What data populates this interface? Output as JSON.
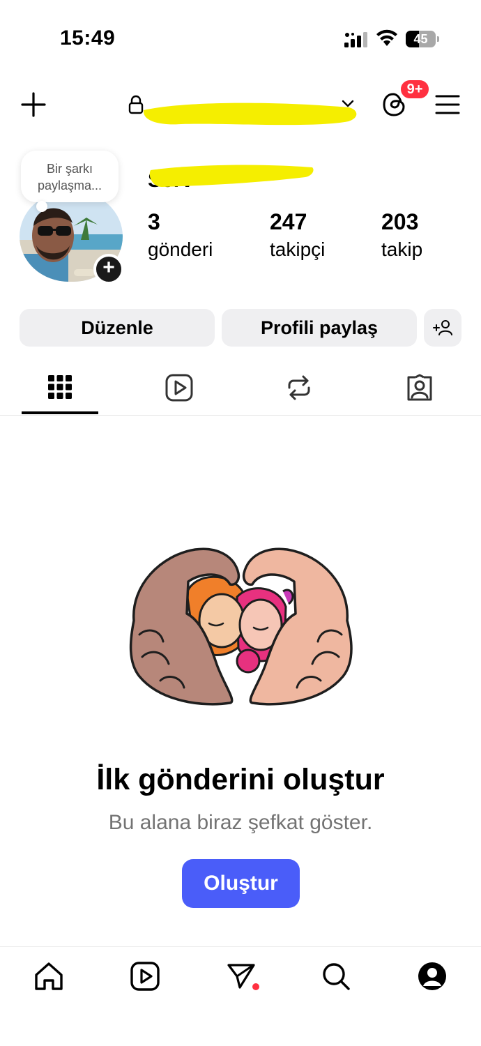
{
  "status_bar": {
    "time": "15:49",
    "battery_level": "45",
    "battery_percent": 45
  },
  "header": {
    "username": "",
    "notifications_badge": "9+",
    "icons": [
      "plus-icon",
      "lock-icon",
      "chevron-down-icon",
      "threads-icon",
      "menu-icon"
    ]
  },
  "profile": {
    "note": "Bir şarkı paylaşma...",
    "display_name": "Serv",
    "stats": [
      {
        "value": "3",
        "label": "gönderi"
      },
      {
        "value": "247",
        "label": "takipçi"
      },
      {
        "value": "203",
        "label": "takip"
      }
    ]
  },
  "actions": {
    "edit_label": "Düzenle",
    "share_label": "Profili paylaş"
  },
  "tabs": [
    {
      "name": "posts-grid",
      "icon": "grid-icon",
      "active": true
    },
    {
      "name": "reels",
      "icon": "reels-icon",
      "active": false
    },
    {
      "name": "reposts",
      "icon": "repost-icon",
      "active": false
    },
    {
      "name": "tagged",
      "icon": "tagged-icon",
      "active": false
    }
  ],
  "empty_state": {
    "title": "İlk gönderini oluştur",
    "subtitle": "Bu alana biraz şefkat göster.",
    "button_label": "Oluştur"
  },
  "bottom_nav": [
    {
      "name": "home",
      "icon": "home-icon"
    },
    {
      "name": "reels",
      "icon": "reels-icon"
    },
    {
      "name": "messages",
      "icon": "send-icon"
    },
    {
      "name": "search",
      "icon": "search-icon"
    },
    {
      "name": "profile",
      "icon": "profile-icon"
    }
  ],
  "colors": {
    "accent": "#4a5df9",
    "badge": "#ff3040",
    "button_bg": "#efeff1",
    "redaction": "#f5ee00"
  }
}
